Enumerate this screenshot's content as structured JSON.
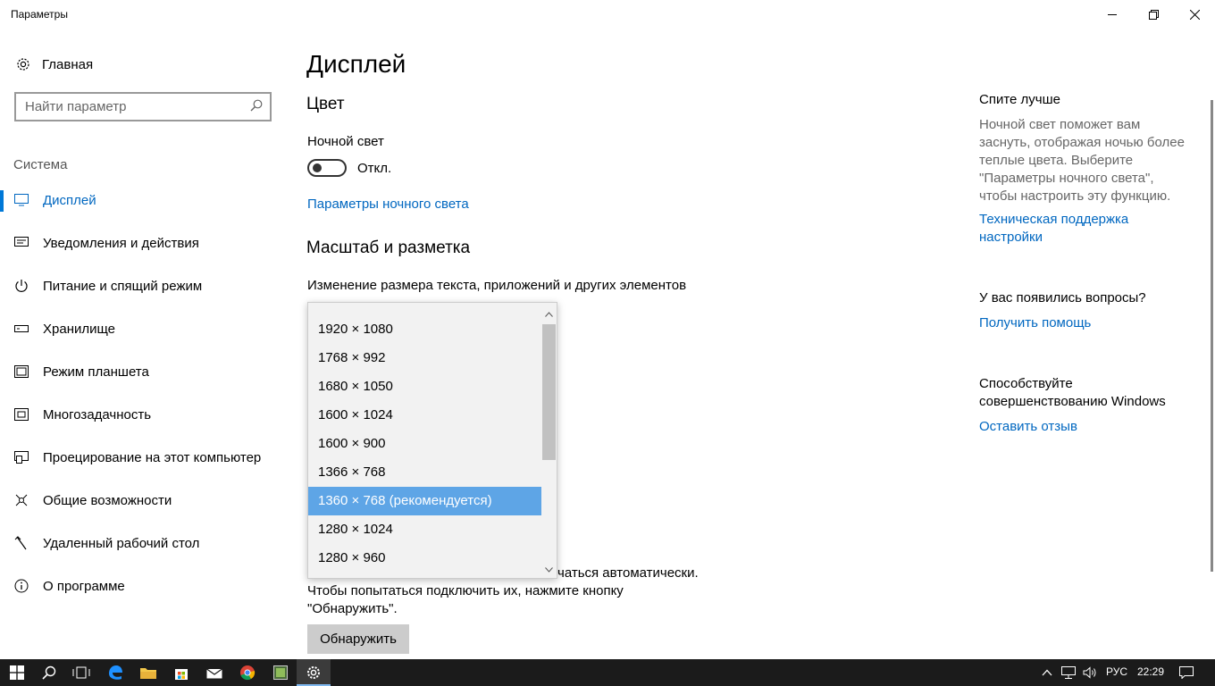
{
  "window": {
    "title": "Параметры"
  },
  "sidebar": {
    "home": "Главная",
    "search_placeholder": "Найти параметр",
    "section": "Система",
    "items": [
      {
        "label": "Дисплей",
        "icon": "display-icon"
      },
      {
        "label": "Уведомления и действия",
        "icon": "notification-icon"
      },
      {
        "label": "Питание и спящий режим",
        "icon": "power-icon"
      },
      {
        "label": "Хранилище",
        "icon": "storage-icon"
      },
      {
        "label": "Режим планшета",
        "icon": "tablet-icon"
      },
      {
        "label": "Многозадачность",
        "icon": "multitask-icon"
      },
      {
        "label": "Проецирование на этот компьютер",
        "icon": "project-icon"
      },
      {
        "label": "Общие возможности",
        "icon": "shared-icon"
      },
      {
        "label": "Удаленный рабочий стол",
        "icon": "remote-desktop-icon"
      },
      {
        "label": "О программе",
        "icon": "info-icon"
      }
    ]
  },
  "main": {
    "title": "Дисплей",
    "color_heading": "Цвет",
    "night_light_label": "Ночной свет",
    "night_light_state": "Откл.",
    "night_light_link": "Параметры ночного света",
    "scale_heading": "Масштаб и разметка",
    "scale_label": "Изменение размера текста, приложений и других элементов",
    "resolution_options": [
      "1920 × 1080",
      "1768 × 992",
      "1680 × 1050",
      "1600 × 1024",
      "1600 × 900",
      "1366 × 768",
      "1360 × 768 (рекомендуется)",
      "1280 × 1024",
      "1280 × 960"
    ],
    "selected_resolution": "1360 × 768 (рекомендуется)",
    "detect_line1_tail": "чаться автоматически.",
    "detect_line2": "Чтобы попытаться подключить их, нажмите кнопку",
    "detect_line3": "\"Обнаружить\".",
    "detect_button": "Обнаружить"
  },
  "right_panel": {
    "sleep_heading": "Спите лучше",
    "sleep_text": "Ночной свет поможет вам заснуть, отображая ночью более теплые цвета. Выберите \"Параметры ночного света\", чтобы настроить эту функцию.",
    "sleep_link": "Техническая поддержка настройки",
    "questions_heading": "У вас появились вопросы?",
    "questions_link": "Получить помощь",
    "contribute_heading": "Способствуйте совершенствованию Windows",
    "contribute_link": "Оставить отзыв"
  },
  "taskbar": {
    "language": "РУС",
    "time": "22:29"
  },
  "colors": {
    "accent": "#0078d7",
    "link": "#0067c0",
    "selected_item": "#5ea5e6",
    "taskbar": "#1b1b1b"
  }
}
